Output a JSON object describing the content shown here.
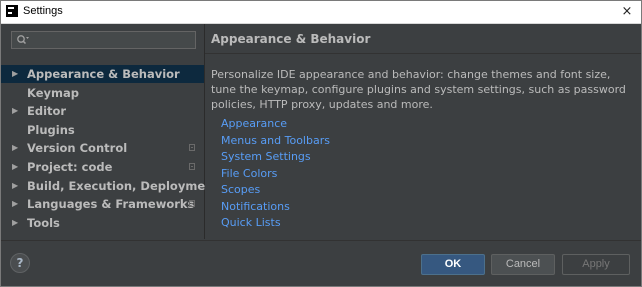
{
  "window": {
    "title": "Settings",
    "close_glyph": "×"
  },
  "sidebar": {
    "search": {
      "value": "",
      "icon": "search-icon"
    },
    "items": [
      {
        "label": "Appearance & Behavior",
        "arrow": "▶",
        "selected": true,
        "project_icon": false
      },
      {
        "label": "Keymap",
        "arrow": "",
        "selected": false,
        "project_icon": false
      },
      {
        "label": "Editor",
        "arrow": "▶",
        "selected": false,
        "project_icon": false
      },
      {
        "label": "Plugins",
        "arrow": "",
        "selected": false,
        "project_icon": false
      },
      {
        "label": "Version Control",
        "arrow": "▶",
        "selected": false,
        "project_icon": true
      },
      {
        "label": "Project: code",
        "arrow": "▶",
        "selected": false,
        "project_icon": true
      },
      {
        "label": "Build, Execution, Deployment",
        "arrow": "▶",
        "selected": false,
        "project_icon": false
      },
      {
        "label": "Languages & Frameworks",
        "arrow": "▶",
        "selected": false,
        "project_icon": true
      },
      {
        "label": "Tools",
        "arrow": "▶",
        "selected": false,
        "project_icon": false
      }
    ]
  },
  "content": {
    "title": "Appearance & Behavior",
    "description": "Personalize IDE appearance and behavior: change themes and font size, tune the keymap, configure plugins and system settings, such as password policies, HTTP proxy, updates and more.",
    "links": [
      "Appearance",
      "Menus and Toolbars",
      "System Settings",
      "File Colors",
      "Scopes",
      "Notifications",
      "Quick Lists"
    ]
  },
  "footer": {
    "help_label": "?",
    "ok_label": "OK",
    "cancel_label": "Cancel",
    "apply_label": "Apply"
  },
  "colors": {
    "background": "#3c3f41",
    "selection": "#0d293e",
    "link": "#589df6",
    "primary_button": "#365880"
  }
}
